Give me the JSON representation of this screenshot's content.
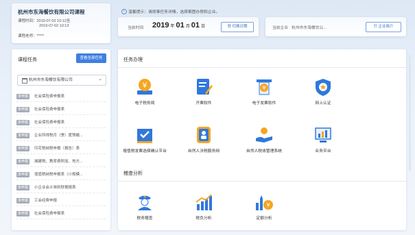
{
  "course": {
    "title": "杭州市东海餐饮有限公司课程",
    "time_label": "课程时间：2019-07-02 10:12至",
    "time_end": "2019-07-02 10:13",
    "teacher": "课程老师：*****"
  },
  "tip": "温馨提示：请按事任务详情，选择案图办税和企业。",
  "date_card": {
    "label": "当前时间",
    "year": "2019",
    "year_unit": "年",
    "month": "01",
    "month_unit": "月",
    "day": "01",
    "day_unit": "日",
    "button": "切换日期"
  },
  "company_card": {
    "label": "当前企业",
    "name": "杭州市东海餐饮公...",
    "button": "企业简介"
  },
  "tasks": {
    "title": "课程任务",
    "view_all": "查看全部任务",
    "company_select": "杭州市东海餐饮有限公司",
    "badge": "未申报",
    "items": [
      "社会保险费申报表",
      "社会保险费申报表",
      "社会保险费申报表",
      "企业所得税月（季）度预缴...",
      "印花税纳税申报（报告）表",
      "城建税、教育费附加、地方...",
      "增值税纳税申报表（小规模...",
      "小企业会计准则财报报表",
      "工会经费申报",
      "社会保险费申报表"
    ]
  },
  "sections": {
    "tasks_title": "任务办理",
    "analysis_title": "稽查分析"
  },
  "tools": [
    {
      "label": "电子税务局",
      "icon": "yuan-card-icon"
    },
    {
      "label": "开票软件",
      "icon": "invoice-pen-icon"
    },
    {
      "label": "电子发票软件",
      "icon": "yuan-printer-icon"
    },
    {
      "label": "网上认证",
      "icon": "shield-check-icon"
    },
    {
      "label": "增值税发票选择确认平台",
      "icon": "check-folder-icon"
    },
    {
      "label": "自然人涉税服务网",
      "icon": "person-app-icon"
    },
    {
      "label": "自然人税收管理系统",
      "icon": "hand-person-icon"
    },
    {
      "label": "业务平台",
      "icon": "monitor-chart-icon"
    }
  ],
  "analysis_tools": [
    {
      "label": "税务稽查",
      "icon": "inspector-icon"
    },
    {
      "label": "税负分析",
      "icon": "bar-chart-icon"
    },
    {
      "label": "定额分析",
      "icon": "bars-coin-icon"
    }
  ],
  "colors": {
    "accent": "#3f7fe0",
    "icon_blue": "#2f78dc",
    "icon_orange": "#f5a623"
  }
}
